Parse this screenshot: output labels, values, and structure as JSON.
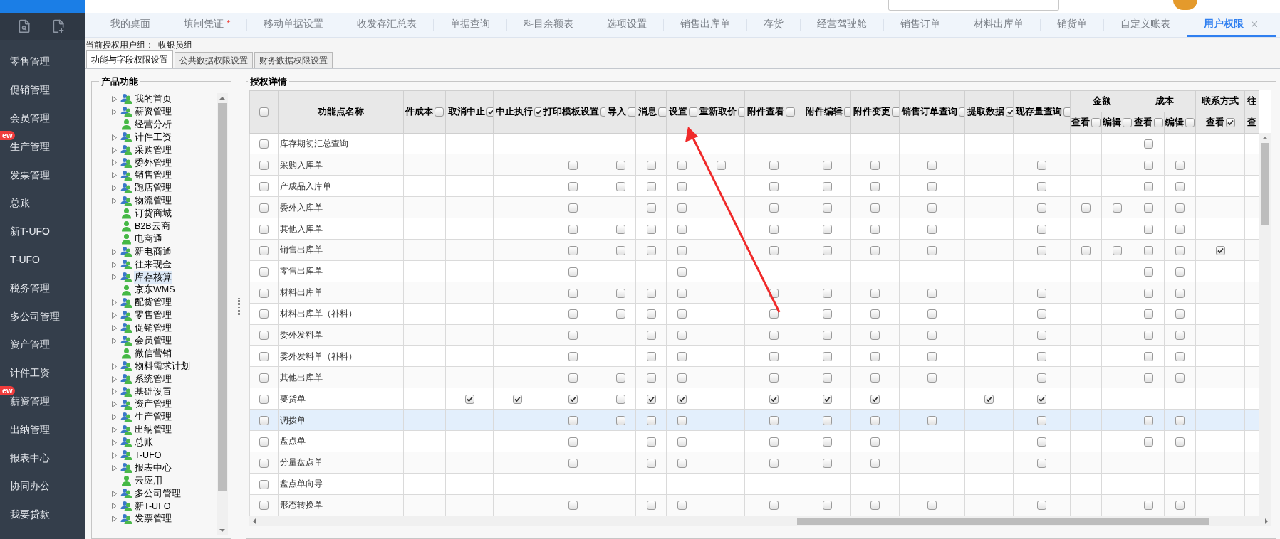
{
  "sidebar": {
    "items": [
      {
        "label": "零售管理"
      },
      {
        "label": "促销管理"
      },
      {
        "label": "会员管理"
      },
      {
        "label": "生产管理",
        "badge": "ew"
      },
      {
        "label": "发票管理"
      },
      {
        "label": "总账"
      },
      {
        "label": "新T-UFO"
      },
      {
        "label": "T-UFO"
      },
      {
        "label": "税务管理"
      },
      {
        "label": "多公司管理"
      },
      {
        "label": "资产管理"
      },
      {
        "label": "计件工资"
      },
      {
        "label": "薪资管理",
        "badge": "ew"
      },
      {
        "label": "出纳管理"
      },
      {
        "label": "报表中心"
      },
      {
        "label": "协同办公"
      },
      {
        "label": "我要贷款"
      }
    ]
  },
  "tabs": [
    {
      "label": "我的桌面",
      "selected": false
    },
    {
      "label": "填制凭证",
      "marker": "*",
      "selected": false
    },
    {
      "label": "移动单据设置",
      "selected": false
    },
    {
      "label": "收发存汇总表",
      "selected": false
    },
    {
      "label": "单据查询",
      "selected": false
    },
    {
      "label": "科目余额表",
      "selected": false
    },
    {
      "label": "选项设置",
      "selected": false
    },
    {
      "label": "销售出库单",
      "selected": false
    },
    {
      "label": "存货",
      "selected": false
    },
    {
      "label": "经营驾驶舱",
      "selected": false
    },
    {
      "label": "销售订单",
      "selected": false
    },
    {
      "label": "材料出库单",
      "selected": false
    },
    {
      "label": "销货单",
      "selected": false
    },
    {
      "label": "自定义账表",
      "selected": false
    },
    {
      "label": "用户权限",
      "selected": true
    }
  ],
  "auth_group": {
    "label": "当前授权用户组：",
    "value": "收银员组"
  },
  "subtabs": [
    {
      "label": "功能与字段权限设置",
      "selected": true
    },
    {
      "label": "公共数据权限设置",
      "selected": false
    },
    {
      "label": "财务数据权限设置",
      "selected": false
    }
  ],
  "product_panel": {
    "title": "产品功能",
    "tree": [
      {
        "label": "我的首页",
        "kind": "group",
        "selected": false
      },
      {
        "label": "薪资管理",
        "kind": "group",
        "selected": false
      },
      {
        "label": "经营分析",
        "kind": "leaf",
        "selected": false
      },
      {
        "label": "计件工资",
        "kind": "group",
        "selected": false
      },
      {
        "label": "采购管理",
        "kind": "group",
        "selected": false
      },
      {
        "label": "委外管理",
        "kind": "group",
        "selected": false
      },
      {
        "label": "销售管理",
        "kind": "group",
        "selected": false
      },
      {
        "label": "跑店管理",
        "kind": "group",
        "selected": false
      },
      {
        "label": "物流管理",
        "kind": "group",
        "selected": false
      },
      {
        "label": "订货商城",
        "kind": "leaf",
        "selected": false
      },
      {
        "label": "B2B云商",
        "kind": "leaf",
        "selected": false
      },
      {
        "label": "电商通",
        "kind": "leaf",
        "selected": false
      },
      {
        "label": "新电商通",
        "kind": "group",
        "selected": false
      },
      {
        "label": "往来现金",
        "kind": "group",
        "selected": false
      },
      {
        "label": "库存核算",
        "kind": "group",
        "selected": true
      },
      {
        "label": "京东WMS",
        "kind": "leaf",
        "selected": false
      },
      {
        "label": "配货管理",
        "kind": "group",
        "selected": false
      },
      {
        "label": "零售管理",
        "kind": "group",
        "selected": false
      },
      {
        "label": "促销管理",
        "kind": "group",
        "selected": false
      },
      {
        "label": "会员管理",
        "kind": "group",
        "selected": false
      },
      {
        "label": "微信营销",
        "kind": "leaf",
        "selected": false
      },
      {
        "label": "物料需求计划",
        "kind": "group",
        "selected": false
      },
      {
        "label": "系统管理",
        "kind": "group",
        "selected": false
      },
      {
        "label": "基础设置",
        "kind": "group",
        "selected": false
      },
      {
        "label": "资产管理",
        "kind": "group",
        "selected": false
      },
      {
        "label": "生产管理",
        "kind": "group",
        "selected": false
      },
      {
        "label": "出纳管理",
        "kind": "group",
        "selected": false
      },
      {
        "label": "总账",
        "kind": "group",
        "selected": false
      },
      {
        "label": "T-UFO",
        "kind": "group",
        "selected": false
      },
      {
        "label": "报表中心",
        "kind": "group",
        "selected": false
      },
      {
        "label": "云应用",
        "kind": "leaf",
        "selected": false
      },
      {
        "label": "多公司管理",
        "kind": "group",
        "selected": false
      },
      {
        "label": "新T-UFO",
        "kind": "group",
        "selected": false
      },
      {
        "label": "发票管理",
        "kind": "group",
        "selected": false
      }
    ]
  },
  "detail_panel": {
    "title": "授权详情",
    "table": {
      "select_all": {
        "checked": false
      },
      "name_header": "功能点名称",
      "columns": [
        {
          "label": "件成本",
          "checked": false
        },
        {
          "label": "取消中止",
          "checked": true
        },
        {
          "label": "中止执行",
          "checked": true
        },
        {
          "label": "打印模板设置",
          "checked": false
        },
        {
          "label": "导入",
          "checked": false
        },
        {
          "label": "消息",
          "checked": false
        },
        {
          "label": "设置",
          "checked": false
        },
        {
          "label": "重新取价",
          "checked": false
        },
        {
          "label": "附件查看",
          "checked": false
        },
        {
          "label": "附件编辑",
          "checked": false
        },
        {
          "label": "附件变更",
          "checked": false
        },
        {
          "label": "销售订单查询",
          "checked": false
        },
        {
          "label": "提取数据",
          "checked": true
        },
        {
          "label": "现存量查询",
          "checked": false
        }
      ],
      "groups": [
        {
          "label": "金额",
          "columns": [
            {
              "label": "查看",
              "checked": false
            },
            {
              "label": "编辑",
              "checked": false
            }
          ]
        },
        {
          "label": "成本",
          "columns": [
            {
              "label": "查看",
              "checked": false
            },
            {
              "label": "编辑",
              "checked": false
            }
          ]
        },
        {
          "label": "联系方式",
          "columns": [
            {
              "label": "查看",
              "checked": true
            }
          ]
        },
        {
          "label": "往",
          "columns": [
            {
              "label": "查"
            }
          ]
        }
      ],
      "rows": [
        {
          "name": "库存期初汇总查询",
          "selected": false,
          "checked": false,
          "cells": [
            {
              "kind": "none"
            },
            {
              "kind": "none"
            },
            {
              "kind": "none"
            },
            {
              "kind": "none"
            },
            {
              "kind": "none"
            },
            {
              "kind": "none"
            },
            {
              "kind": "none"
            },
            {
              "kind": "none"
            },
            {
              "kind": "none"
            },
            {
              "kind": "none"
            },
            {
              "kind": "none"
            },
            {
              "kind": "none"
            },
            {
              "kind": "none"
            },
            {
              "kind": "none"
            },
            {
              "kind": "none"
            },
            {
              "kind": "none"
            },
            {
              "kind": "box",
              "checked": false
            },
            {
              "kind": "none"
            },
            {
              "kind": "none"
            },
            {
              "kind": "none"
            }
          ]
        },
        {
          "name": "采购入库单",
          "selected": false,
          "checked": false,
          "cells": [
            {
              "kind": "none"
            },
            {
              "kind": "none"
            },
            {
              "kind": "none"
            },
            {
              "kind": "box",
              "checked": false
            },
            {
              "kind": "box",
              "checked": false
            },
            {
              "kind": "box",
              "checked": false
            },
            {
              "kind": "box",
              "checked": false
            },
            {
              "kind": "box",
              "checked": false
            },
            {
              "kind": "box",
              "checked": false
            },
            {
              "kind": "box",
              "checked": false
            },
            {
              "kind": "box",
              "checked": false
            },
            {
              "kind": "box",
              "checked": false
            },
            {
              "kind": "none"
            },
            {
              "kind": "box",
              "checked": false
            },
            {
              "kind": "none"
            },
            {
              "kind": "none"
            },
            {
              "kind": "box",
              "checked": false
            },
            {
              "kind": "box",
              "checked": false
            },
            {
              "kind": "none"
            },
            {
              "kind": "none"
            }
          ]
        },
        {
          "name": "产成品入库单",
          "selected": false,
          "checked": false,
          "cells": [
            {
              "kind": "none"
            },
            {
              "kind": "none"
            },
            {
              "kind": "none"
            },
            {
              "kind": "box",
              "checked": false
            },
            {
              "kind": "box",
              "checked": false
            },
            {
              "kind": "box",
              "checked": false
            },
            {
              "kind": "box",
              "checked": false
            },
            {
              "kind": "none"
            },
            {
              "kind": "box",
              "checked": false
            },
            {
              "kind": "box",
              "checked": false
            },
            {
              "kind": "box",
              "checked": false
            },
            {
              "kind": "box",
              "checked": false
            },
            {
              "kind": "none"
            },
            {
              "kind": "box",
              "checked": false
            },
            {
              "kind": "none"
            },
            {
              "kind": "none"
            },
            {
              "kind": "box",
              "checked": false
            },
            {
              "kind": "box",
              "checked": false
            },
            {
              "kind": "none"
            },
            {
              "kind": "none"
            }
          ]
        },
        {
          "name": "委外入库单",
          "selected": false,
          "checked": false,
          "cells": [
            {
              "kind": "none"
            },
            {
              "kind": "none"
            },
            {
              "kind": "none"
            },
            {
              "kind": "box",
              "checked": false
            },
            {
              "kind": "none"
            },
            {
              "kind": "box",
              "checked": false
            },
            {
              "kind": "box",
              "checked": false
            },
            {
              "kind": "none"
            },
            {
              "kind": "box",
              "checked": false
            },
            {
              "kind": "box",
              "checked": false
            },
            {
              "kind": "box",
              "checked": false
            },
            {
              "kind": "box",
              "checked": false
            },
            {
              "kind": "none"
            },
            {
              "kind": "box",
              "checked": false
            },
            {
              "kind": "box",
              "checked": false
            },
            {
              "kind": "box",
              "checked": false
            },
            {
              "kind": "box",
              "checked": false
            },
            {
              "kind": "box",
              "checked": false
            },
            {
              "kind": "none"
            },
            {
              "kind": "none"
            }
          ]
        },
        {
          "name": "其他入库单",
          "selected": false,
          "checked": false,
          "cells": [
            {
              "kind": "none"
            },
            {
              "kind": "none"
            },
            {
              "kind": "none"
            },
            {
              "kind": "box",
              "checked": false
            },
            {
              "kind": "box",
              "checked": false
            },
            {
              "kind": "box",
              "checked": false
            },
            {
              "kind": "box",
              "checked": false
            },
            {
              "kind": "none"
            },
            {
              "kind": "box",
              "checked": false
            },
            {
              "kind": "box",
              "checked": false
            },
            {
              "kind": "box",
              "checked": false
            },
            {
              "kind": "box",
              "checked": false
            },
            {
              "kind": "none"
            },
            {
              "kind": "box",
              "checked": false
            },
            {
              "kind": "none"
            },
            {
              "kind": "none"
            },
            {
              "kind": "box",
              "checked": false
            },
            {
              "kind": "box",
              "checked": false
            },
            {
              "kind": "none"
            },
            {
              "kind": "none"
            }
          ]
        },
        {
          "name": "销售出库单",
          "selected": false,
          "checked": false,
          "cells": [
            {
              "kind": "none"
            },
            {
              "kind": "none"
            },
            {
              "kind": "none"
            },
            {
              "kind": "box",
              "checked": false
            },
            {
              "kind": "box",
              "checked": false
            },
            {
              "kind": "box",
              "checked": false
            },
            {
              "kind": "box",
              "checked": false
            },
            {
              "kind": "none"
            },
            {
              "kind": "box",
              "checked": false
            },
            {
              "kind": "box",
              "checked": false
            },
            {
              "kind": "box",
              "checked": false
            },
            {
              "kind": "box",
              "checked": false
            },
            {
              "kind": "none"
            },
            {
              "kind": "box",
              "checked": false
            },
            {
              "kind": "box",
              "checked": false
            },
            {
              "kind": "box",
              "checked": false
            },
            {
              "kind": "box",
              "checked": false
            },
            {
              "kind": "box",
              "checked": false
            },
            {
              "kind": "box",
              "checked": true
            },
            {
              "kind": "none"
            }
          ]
        },
        {
          "name": "零售出库单",
          "selected": false,
          "checked": false,
          "cells": [
            {
              "kind": "none"
            },
            {
              "kind": "none"
            },
            {
              "kind": "none"
            },
            {
              "kind": "box",
              "checked": false
            },
            {
              "kind": "none"
            },
            {
              "kind": "none"
            },
            {
              "kind": "box",
              "checked": false
            },
            {
              "kind": "none"
            },
            {
              "kind": "none"
            },
            {
              "kind": "none"
            },
            {
              "kind": "none"
            },
            {
              "kind": "none"
            },
            {
              "kind": "none"
            },
            {
              "kind": "none"
            },
            {
              "kind": "none"
            },
            {
              "kind": "none"
            },
            {
              "kind": "box",
              "checked": false
            },
            {
              "kind": "box",
              "checked": false
            },
            {
              "kind": "none"
            },
            {
              "kind": "none"
            }
          ]
        },
        {
          "name": "材料出库单",
          "selected": false,
          "checked": false,
          "cells": [
            {
              "kind": "none"
            },
            {
              "kind": "none"
            },
            {
              "kind": "none"
            },
            {
              "kind": "box",
              "checked": false
            },
            {
              "kind": "box",
              "checked": false
            },
            {
              "kind": "box",
              "checked": false
            },
            {
              "kind": "box",
              "checked": false
            },
            {
              "kind": "none"
            },
            {
              "kind": "box",
              "checked": false
            },
            {
              "kind": "box",
              "checked": false
            },
            {
              "kind": "box",
              "checked": false
            },
            {
              "kind": "box",
              "checked": false
            },
            {
              "kind": "none"
            },
            {
              "kind": "box",
              "checked": false
            },
            {
              "kind": "none"
            },
            {
              "kind": "none"
            },
            {
              "kind": "box",
              "checked": false
            },
            {
              "kind": "box",
              "checked": false
            },
            {
              "kind": "none"
            },
            {
              "kind": "none"
            }
          ]
        },
        {
          "name": "材料出库单（补料）",
          "selected": false,
          "checked": false,
          "cells": [
            {
              "kind": "none"
            },
            {
              "kind": "none"
            },
            {
              "kind": "none"
            },
            {
              "kind": "box",
              "checked": false
            },
            {
              "kind": "box",
              "checked": false
            },
            {
              "kind": "box",
              "checked": false
            },
            {
              "kind": "box",
              "checked": false
            },
            {
              "kind": "none"
            },
            {
              "kind": "box",
              "checked": false
            },
            {
              "kind": "box",
              "checked": false
            },
            {
              "kind": "box",
              "checked": false
            },
            {
              "kind": "box",
              "checked": false
            },
            {
              "kind": "none"
            },
            {
              "kind": "box",
              "checked": false
            },
            {
              "kind": "none"
            },
            {
              "kind": "none"
            },
            {
              "kind": "box",
              "checked": false
            },
            {
              "kind": "box",
              "checked": false
            },
            {
              "kind": "none"
            },
            {
              "kind": "none"
            }
          ]
        },
        {
          "name": "委外发料单",
          "selected": false,
          "checked": false,
          "cells": [
            {
              "kind": "none"
            },
            {
              "kind": "none"
            },
            {
              "kind": "none"
            },
            {
              "kind": "box",
              "checked": false
            },
            {
              "kind": "none"
            },
            {
              "kind": "box",
              "checked": false
            },
            {
              "kind": "box",
              "checked": false
            },
            {
              "kind": "none"
            },
            {
              "kind": "box",
              "checked": false
            },
            {
              "kind": "box",
              "checked": false
            },
            {
              "kind": "box",
              "checked": false
            },
            {
              "kind": "box",
              "checked": false
            },
            {
              "kind": "none"
            },
            {
              "kind": "box",
              "checked": false
            },
            {
              "kind": "none"
            },
            {
              "kind": "none"
            },
            {
              "kind": "box",
              "checked": false
            },
            {
              "kind": "box",
              "checked": false
            },
            {
              "kind": "none"
            },
            {
              "kind": "none"
            }
          ]
        },
        {
          "name": "委外发料单（补料）",
          "selected": false,
          "checked": false,
          "cells": [
            {
              "kind": "none"
            },
            {
              "kind": "none"
            },
            {
              "kind": "none"
            },
            {
              "kind": "box",
              "checked": false
            },
            {
              "kind": "none"
            },
            {
              "kind": "box",
              "checked": false
            },
            {
              "kind": "box",
              "checked": false
            },
            {
              "kind": "none"
            },
            {
              "kind": "box",
              "checked": false
            },
            {
              "kind": "box",
              "checked": false
            },
            {
              "kind": "box",
              "checked": false
            },
            {
              "kind": "box",
              "checked": false
            },
            {
              "kind": "none"
            },
            {
              "kind": "box",
              "checked": false
            },
            {
              "kind": "none"
            },
            {
              "kind": "none"
            },
            {
              "kind": "box",
              "checked": false
            },
            {
              "kind": "box",
              "checked": false
            },
            {
              "kind": "none"
            },
            {
              "kind": "none"
            }
          ]
        },
        {
          "name": "其他出库单",
          "selected": false,
          "checked": false,
          "cells": [
            {
              "kind": "none"
            },
            {
              "kind": "none"
            },
            {
              "kind": "none"
            },
            {
              "kind": "box",
              "checked": false
            },
            {
              "kind": "box",
              "checked": false
            },
            {
              "kind": "box",
              "checked": false
            },
            {
              "kind": "box",
              "checked": false
            },
            {
              "kind": "none"
            },
            {
              "kind": "box",
              "checked": false
            },
            {
              "kind": "box",
              "checked": false
            },
            {
              "kind": "box",
              "checked": false
            },
            {
              "kind": "box",
              "checked": false
            },
            {
              "kind": "none"
            },
            {
              "kind": "box",
              "checked": false
            },
            {
              "kind": "none"
            },
            {
              "kind": "none"
            },
            {
              "kind": "box",
              "checked": false
            },
            {
              "kind": "box",
              "checked": false
            },
            {
              "kind": "none"
            },
            {
              "kind": "none"
            }
          ]
        },
        {
          "name": "要货单",
          "selected": false,
          "checked": false,
          "cells": [
            {
              "kind": "none"
            },
            {
              "kind": "box",
              "checked": true
            },
            {
              "kind": "box",
              "checked": true
            },
            {
              "kind": "box",
              "checked": true
            },
            {
              "kind": "box",
              "checked": false
            },
            {
              "kind": "box",
              "checked": true
            },
            {
              "kind": "box",
              "checked": true
            },
            {
              "kind": "none"
            },
            {
              "kind": "box",
              "checked": true
            },
            {
              "kind": "box",
              "checked": true
            },
            {
              "kind": "box",
              "checked": true
            },
            {
              "kind": "none"
            },
            {
              "kind": "box",
              "checked": true
            },
            {
              "kind": "box",
              "checked": true
            },
            {
              "kind": "none"
            },
            {
              "kind": "none"
            },
            {
              "kind": "none"
            },
            {
              "kind": "none"
            },
            {
              "kind": "none"
            },
            {
              "kind": "none"
            }
          ]
        },
        {
          "name": "调拨单",
          "selected": true,
          "checked": false,
          "cells": [
            {
              "kind": "none"
            },
            {
              "kind": "none"
            },
            {
              "kind": "none"
            },
            {
              "kind": "box",
              "checked": false
            },
            {
              "kind": "box",
              "checked": false
            },
            {
              "kind": "box",
              "checked": false
            },
            {
              "kind": "box",
              "checked": false
            },
            {
              "kind": "none"
            },
            {
              "kind": "box",
              "checked": false
            },
            {
              "kind": "box",
              "checked": false
            },
            {
              "kind": "box",
              "checked": false
            },
            {
              "kind": "box",
              "checked": false
            },
            {
              "kind": "none"
            },
            {
              "kind": "box",
              "checked": false
            },
            {
              "kind": "none"
            },
            {
              "kind": "none"
            },
            {
              "kind": "box",
              "checked": false
            },
            {
              "kind": "box",
              "checked": false
            },
            {
              "kind": "none"
            },
            {
              "kind": "none"
            }
          ]
        },
        {
          "name": "盘点单",
          "selected": false,
          "checked": false,
          "cells": [
            {
              "kind": "none"
            },
            {
              "kind": "none"
            },
            {
              "kind": "none"
            },
            {
              "kind": "box",
              "checked": false
            },
            {
              "kind": "none"
            },
            {
              "kind": "box",
              "checked": false
            },
            {
              "kind": "box",
              "checked": false
            },
            {
              "kind": "none"
            },
            {
              "kind": "box",
              "checked": false
            },
            {
              "kind": "box",
              "checked": false
            },
            {
              "kind": "box",
              "checked": false
            },
            {
              "kind": "none"
            },
            {
              "kind": "none"
            },
            {
              "kind": "box",
              "checked": false
            },
            {
              "kind": "none"
            },
            {
              "kind": "none"
            },
            {
              "kind": "box",
              "checked": false
            },
            {
              "kind": "box",
              "checked": false
            },
            {
              "kind": "none"
            },
            {
              "kind": "none"
            }
          ]
        },
        {
          "name": "分量盘点单",
          "selected": false,
          "checked": false,
          "cells": [
            {
              "kind": "none"
            },
            {
              "kind": "none"
            },
            {
              "kind": "none"
            },
            {
              "kind": "box",
              "checked": false
            },
            {
              "kind": "none"
            },
            {
              "kind": "box",
              "checked": false
            },
            {
              "kind": "box",
              "checked": false
            },
            {
              "kind": "none"
            },
            {
              "kind": "box",
              "checked": false
            },
            {
              "kind": "box",
              "checked": false
            },
            {
              "kind": "box",
              "checked": false
            },
            {
              "kind": "none"
            },
            {
              "kind": "none"
            },
            {
              "kind": "box",
              "checked": false
            },
            {
              "kind": "none"
            },
            {
              "kind": "none"
            },
            {
              "kind": "none"
            },
            {
              "kind": "none"
            },
            {
              "kind": "none"
            },
            {
              "kind": "none"
            }
          ]
        },
        {
          "name": "盘点单向导",
          "selected": false,
          "checked": false,
          "cells": [
            {
              "kind": "none"
            },
            {
              "kind": "none"
            },
            {
              "kind": "none"
            },
            {
              "kind": "none"
            },
            {
              "kind": "none"
            },
            {
              "kind": "none"
            },
            {
              "kind": "none"
            },
            {
              "kind": "none"
            },
            {
              "kind": "none"
            },
            {
              "kind": "none"
            },
            {
              "kind": "none"
            },
            {
              "kind": "none"
            },
            {
              "kind": "none"
            },
            {
              "kind": "none"
            },
            {
              "kind": "none"
            },
            {
              "kind": "none"
            },
            {
              "kind": "none"
            },
            {
              "kind": "none"
            },
            {
              "kind": "none"
            },
            {
              "kind": "none"
            }
          ]
        },
        {
          "name": "形态转换单",
          "selected": false,
          "checked": false,
          "cells": [
            {
              "kind": "none"
            },
            {
              "kind": "none"
            },
            {
              "kind": "none"
            },
            {
              "kind": "box",
              "checked": false
            },
            {
              "kind": "none"
            },
            {
              "kind": "box",
              "checked": false
            },
            {
              "kind": "box",
              "checked": false
            },
            {
              "kind": "none"
            },
            {
              "kind": "box",
              "checked": false
            },
            {
              "kind": "box",
              "checked": false
            },
            {
              "kind": "box",
              "checked": false
            },
            {
              "kind": "box",
              "checked": false
            },
            {
              "kind": "none"
            },
            {
              "kind": "box",
              "checked": false
            },
            {
              "kind": "none"
            },
            {
              "kind": "none"
            },
            {
              "kind": "box",
              "checked": false
            },
            {
              "kind": "box",
              "checked": false
            },
            {
              "kind": "none"
            },
            {
              "kind": "none"
            }
          ]
        }
      ]
    }
  }
}
